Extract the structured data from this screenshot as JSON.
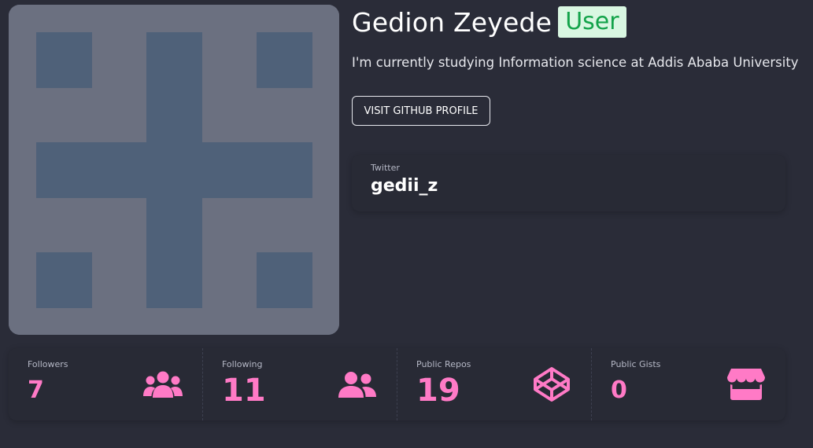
{
  "profile": {
    "name": "Gedion Zeyede",
    "badge": "User",
    "bio": "I'm currently studying Information science at Addis Ababa University",
    "github_button_label": "VISIT GITHUB PROFILE"
  },
  "twitter": {
    "label": "Twitter",
    "handle": "gedii_z"
  },
  "stats": [
    {
      "label": "Followers",
      "value": "7",
      "icon": "users-icon"
    },
    {
      "label": "Following",
      "value": "11",
      "icon": "user-friends-icon"
    },
    {
      "label": "Public Repos",
      "value": "19",
      "icon": "codepen-icon"
    },
    {
      "label": "Public Gists",
      "value": "0",
      "icon": "store-icon"
    }
  ],
  "colors": {
    "background": "#2a2c38",
    "accent_pink": "#ff7ac6",
    "badge_bg": "#d9f7e2",
    "badge_text": "#13a34a",
    "avatar_bg": "#6b7080",
    "avatar_fg": "#4f6179"
  }
}
